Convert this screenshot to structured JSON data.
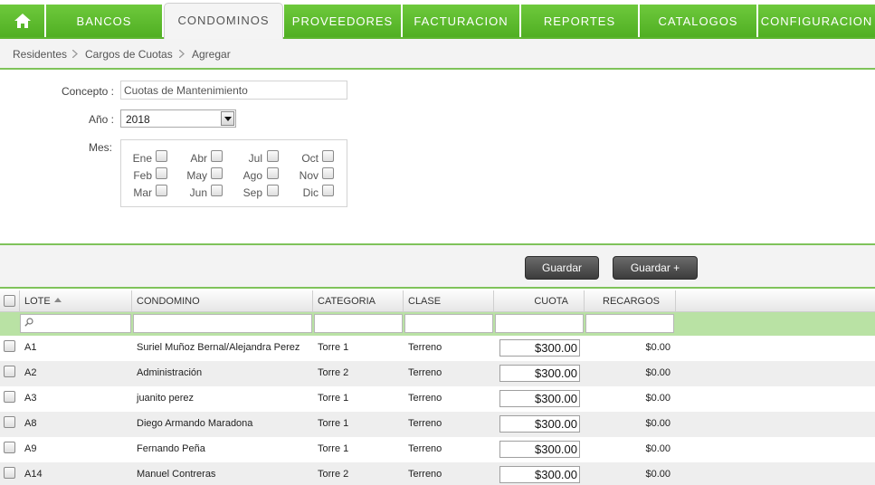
{
  "nav": {
    "home_icon": "home-icon",
    "tabs": [
      {
        "label": "BANCOS"
      },
      {
        "label": "CONDOMINOS"
      },
      {
        "label": "PROVEEDORES"
      },
      {
        "label": "FACTURACION"
      },
      {
        "label": "REPORTES"
      },
      {
        "label": "CATALOGOS"
      },
      {
        "label": "CONFIGURACION"
      }
    ],
    "active_tab": "CONDOMINOS",
    "accent_color": "#5cb630"
  },
  "breadcrumb": [
    "Residentes",
    "Cargos de Cuotas",
    "Agregar"
  ],
  "form": {
    "concepto_label": "Concepto :",
    "concepto_value": "Cuotas de Mantenimiento",
    "anio_label": "Año :",
    "anio_value": "2018",
    "mes_label": "Mes:",
    "months": [
      "Ene",
      "Feb",
      "Mar",
      "Abr",
      "May",
      "Jun",
      "Jul",
      "Ago",
      "Sep",
      "Oct",
      "Nov",
      "Dic"
    ]
  },
  "actions": {
    "guardar": "Guardar",
    "guardar_plus": "Guardar +"
  },
  "grid": {
    "columns": [
      "LOTE",
      "CONDOMINO",
      "CATEGORIA",
      "CLASE",
      "CUOTA",
      "RECARGOS"
    ],
    "rows": [
      {
        "lote": "A1",
        "condomino": "Suriel Muñoz Bernal/Alejandra Perez",
        "categoria": "Torre 1",
        "clase": "Terreno",
        "cuota": "$300.00",
        "recargos": "$0.00"
      },
      {
        "lote": "A2",
        "condomino": "Administración",
        "categoria": "Torre 2",
        "clase": "Terreno",
        "cuota": "$300.00",
        "recargos": "$0.00"
      },
      {
        "lote": "A3",
        "condomino": "juanito perez",
        "categoria": "Torre 1",
        "clase": "Terreno",
        "cuota": "$300.00",
        "recargos": "$0.00"
      },
      {
        "lote": "A8",
        "condomino": "Diego Armando Maradona",
        "categoria": "Torre 1",
        "clase": "Terreno",
        "cuota": "$300.00",
        "recargos": "$0.00"
      },
      {
        "lote": "A9",
        "condomino": "Fernando Peña",
        "categoria": "Torre 1",
        "clase": "Terreno",
        "cuota": "$300.00",
        "recargos": "$0.00"
      },
      {
        "lote": "A14",
        "condomino": "Manuel Contreras",
        "categoria": "Torre 2",
        "clase": "Terreno",
        "cuota": "$300.00",
        "recargos": "$0.00"
      }
    ]
  }
}
